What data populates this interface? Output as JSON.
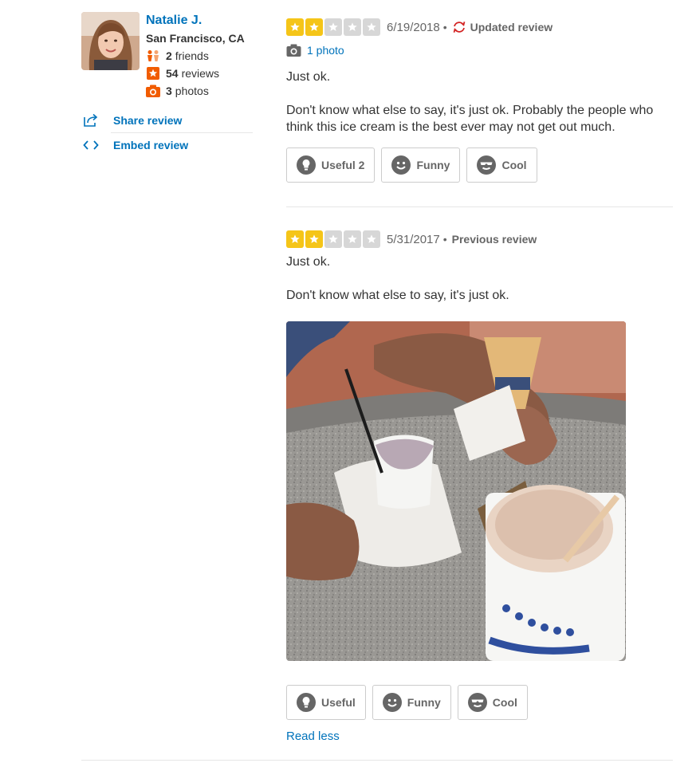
{
  "user": {
    "name": "Natalie J.",
    "location": "San Francisco, CA",
    "friends_count": "2",
    "friends_label": "friends",
    "reviews_count": "54",
    "reviews_label": "reviews",
    "photos_count": "3",
    "photos_label": "photos"
  },
  "actions": {
    "share_label": "Share review",
    "embed_label": "Embed review"
  },
  "reviews": [
    {
      "rating": 2,
      "max_rating": 5,
      "date": "6/19/2018",
      "tag": "Updated review",
      "photo_count_label": "1 photo",
      "title_text": "Just ok.",
      "body_text": "Don't know what else to say, it's just ok. Probably the people who think this ice cream is the best ever may not get out much.",
      "votes": {
        "useful": "Useful 2",
        "funny": "Funny",
        "cool": "Cool"
      }
    },
    {
      "rating": 2,
      "max_rating": 5,
      "date": "5/31/2017",
      "tag": "Previous review",
      "title_text": "Just ok.",
      "body_text": "Don't know what else to say, it's just ok.",
      "votes": {
        "useful": "Useful",
        "funny": "Funny",
        "cool": "Cool"
      },
      "read_less_label": "Read less"
    }
  ],
  "icons": {
    "friends": "friends-icon",
    "reviews": "star-badge-icon",
    "photos": "camera-icon",
    "share": "share-icon",
    "embed": "code-brackets-icon",
    "updated": "refresh-icon",
    "useful": "lightbulb-icon",
    "funny": "smile-face-icon",
    "cool": "sunglasses-face-icon"
  },
  "colors": {
    "link": "#0073bb",
    "star_on": "#f5c518",
    "star_off": "#d7d7d7",
    "orange": "#f15c00",
    "updated": "#d32323"
  }
}
